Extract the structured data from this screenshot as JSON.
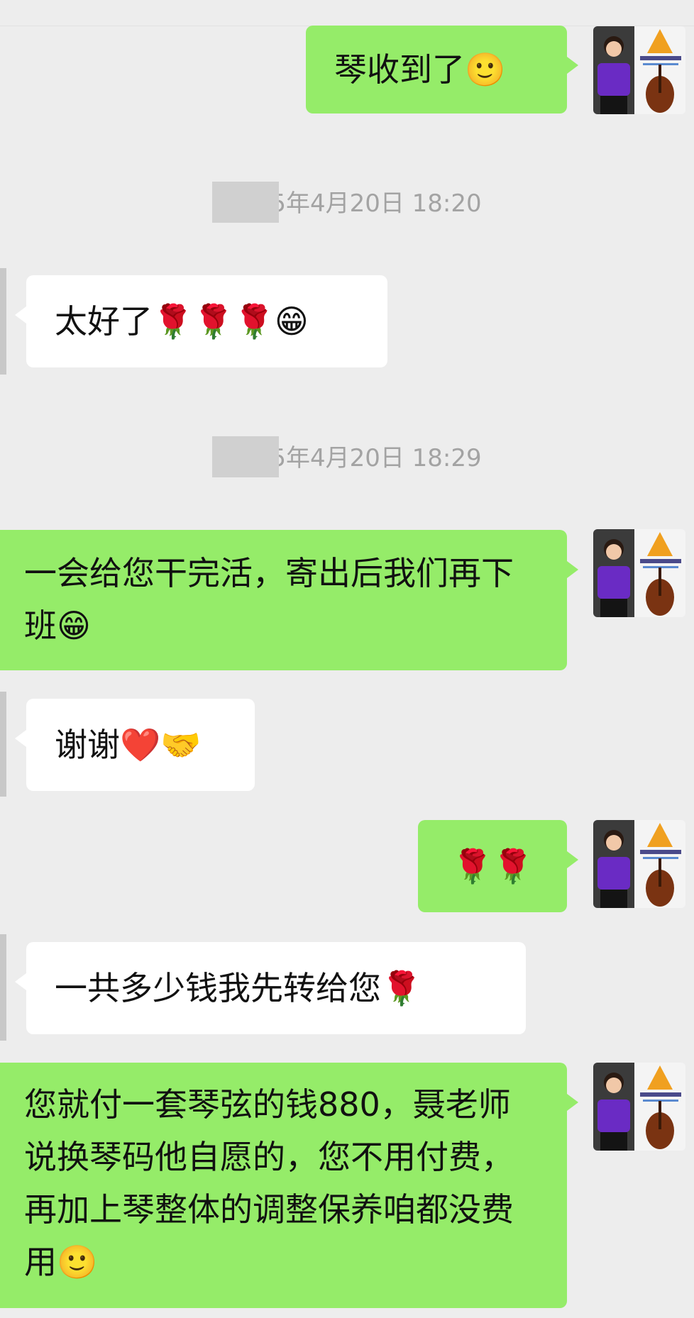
{
  "timestamps": [
    {
      "text": "5年4月20日 18:20"
    },
    {
      "text": "5年4月20日 18:29"
    }
  ],
  "messages": [
    {
      "from": "me",
      "text": "琴收到了🙂"
    },
    {
      "from": "other",
      "text": "太好了🌹🌹🌹😁"
    },
    {
      "from": "me",
      "text": "一会给您干完活，寄出后我们再下班😁"
    },
    {
      "from": "other",
      "text": "谢谢❤️🤝"
    },
    {
      "from": "me",
      "text": "🌹🌹"
    },
    {
      "from": "other",
      "text": "一共多少钱我先转给您🌹"
    },
    {
      "from": "me",
      "text": "您就付一套琴弦的钱880，聂老师说换琴码他自愿的，您不用付费，再加上琴整体的调整保养咱都没费用🙂"
    }
  ],
  "colors": {
    "background": "#ededed",
    "my_bubble": "#95ec69",
    "other_bubble": "#ffffff",
    "timestamp_text": "#a3a3a3"
  },
  "avatar": {
    "description_icon": "user-photo-with-violin-logo-icon"
  }
}
